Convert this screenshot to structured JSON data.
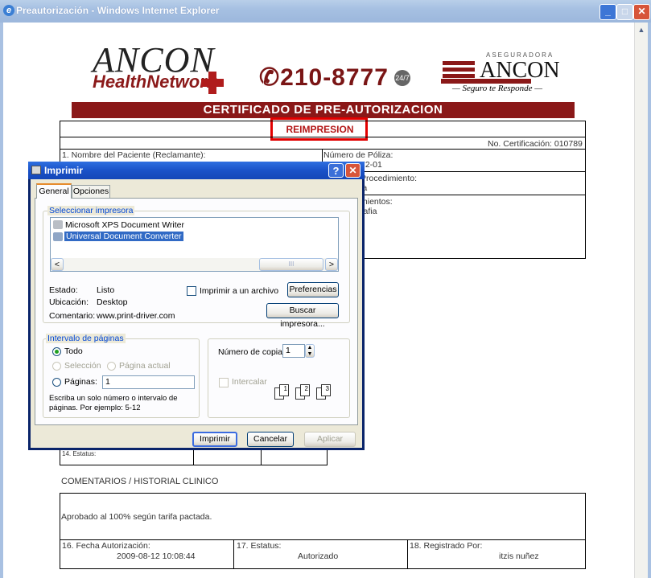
{
  "window": {
    "title": "Preautorización - Windows Internet Explorer",
    "min_glyph": "_",
    "max_glyph": "□",
    "close_glyph": "✕",
    "scroll_up_glyph": "▲"
  },
  "document": {
    "logo_main": "ANCON",
    "logo_sub": "HealthNetwork",
    "phone": "✆210-8777",
    "phone_badge": "24/7",
    "insurer_top": "ASEGURADORA",
    "insurer_name": "ANCON",
    "insurer_tagline": "— Seguro te Responde —",
    "band_title": "CERTIFICADO DE PRE-AUTORIZACION",
    "reprint": "REIMPRESION",
    "cert_number": "No. Certificación: 010789",
    "patient_label": "1. Nombre del Paciente (Reclamante):",
    "policy_label": "Número de Póliza:",
    "policy_value": "72-01",
    "procedure_label": "Procedimiento:",
    "procedure_value": "ia",
    "procedures_label": "mientos:",
    "procedures_value": "rafia",
    "status_row_label": "14. Estatus:",
    "comments_heading": "COMENTARIOS / HISTORIAL CLINICO",
    "comment_text": "Aprobado al 100% según tarifa pactada.",
    "auth_date_label": "16. Fecha Autorización:",
    "auth_date_value": "2009-08-12 10:08:44",
    "status_label": "17. Estatus:",
    "status_value": "Autorizado",
    "registered_label": "18. Registrado Por:",
    "registered_value": "itzis nuñez"
  },
  "dialog": {
    "title": "Imprimir",
    "help_glyph": "?",
    "close_glyph": "✕",
    "tabs": [
      "General",
      "Opciones"
    ],
    "printer_group": "Seleccionar impresora",
    "printers": [
      "Microsoft XPS Document Writer",
      "Universal Document Converter"
    ],
    "selected_printer_index": 1,
    "scroll_left": "<",
    "scroll_right": ">",
    "scroll_thumb": "III",
    "status_label": "Estado:",
    "status_value": "Listo",
    "location_label": "Ubicación:",
    "location_value": "Desktop",
    "comment_label": "Comentario:",
    "comment_value": "www.print-driver.com",
    "print_to_file": "Imprimir a un archivo",
    "preferences": "Preferencias",
    "find_printer": "Buscar impresora...",
    "range_group": "Intervalo de páginas",
    "range_all": "Todo",
    "range_selection": "Selección",
    "range_current": "Página actual",
    "range_pages": "Páginas:",
    "pages_value": "1",
    "range_hint_1": "Escriba un solo número o intervalo de",
    "range_hint_2": "páginas. Por ejemplo: 5-12",
    "copies_label": "Número de copias:",
    "copies_value": "1",
    "collate_label": "Intercalar",
    "collate_pages": [
      "1",
      "1",
      "2",
      "2",
      "3",
      "3"
    ],
    "print_button": "Imprimir",
    "cancel_button": "Cancelar",
    "apply_button": "Aplicar"
  }
}
